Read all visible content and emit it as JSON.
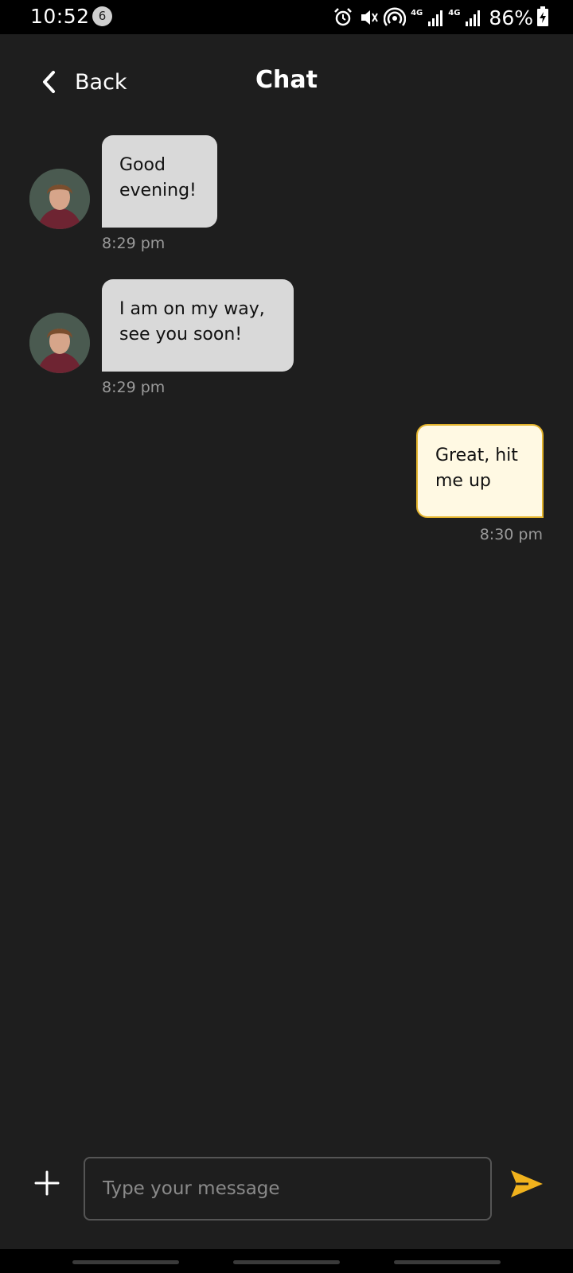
{
  "status_bar": {
    "time": "10:52",
    "notification_count": "6",
    "net1": "4G",
    "net2": "4G",
    "battery": "86%"
  },
  "header": {
    "back_label": "Back",
    "title": "Chat"
  },
  "messages": [
    {
      "direction": "incoming",
      "text_line1": "Good",
      "text_line2": "evening!",
      "time": "8:29 pm"
    },
    {
      "direction": "incoming",
      "text_line1": "I am on my way,",
      "text_line2": "see you soon!",
      "time": "8:29 pm"
    },
    {
      "direction": "outgoing",
      "text_line1": "Great, hit",
      "text_line2": "me up",
      "time": "8:30 pm"
    }
  ],
  "composer": {
    "placeholder": "Type your message",
    "value": ""
  },
  "colors": {
    "background": "#1e1e1e",
    "incoming_bubble": "#d9d9d9",
    "outgoing_bubble": "#fff9e3",
    "accent": "#e3b32b",
    "send_icon": "#f0b21d"
  },
  "icons": {
    "back": "chevron-left-icon",
    "add": "plus-icon",
    "send": "send-icon"
  }
}
